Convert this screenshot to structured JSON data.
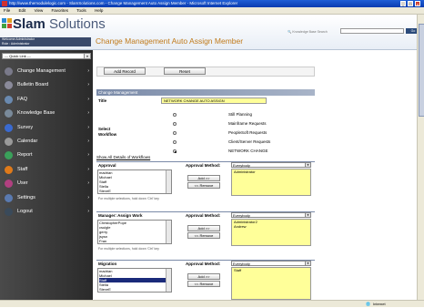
{
  "window": {
    "title": "http://www.themodulelogic.com - SlamSolutions.com - Change Management Auto Assign Member - Microsoft Internet Explorer",
    "min": "_",
    "max": "□",
    "close": "x"
  },
  "menu": [
    "File",
    "Edit",
    "View",
    "Favorites",
    "Tools",
    "Help"
  ],
  "header": {
    "brand_bold": "Slam",
    "brand_light": " Solutions",
    "search_label": "Knowledge Base Search",
    "go": "Go",
    "user_line1": "Welcome Administrator",
    "user_line2": "Role : Administrator",
    "page_title": "Change Management Auto Assign Member"
  },
  "sidebar": {
    "quicklink": "--- Quick Link ---",
    "items": [
      {
        "label": "Change Management",
        "icon": "change-icon",
        "color": "#7a7a8a"
      },
      {
        "label": "Bulletin Board",
        "icon": "bulletin-icon",
        "color": "#8a8a9a"
      },
      {
        "label": "FAQ",
        "icon": "faq-icon",
        "color": "#6a8ab0"
      },
      {
        "label": "Knowledge Base",
        "icon": "knowledge-icon",
        "color": "#7a8a9a"
      },
      {
        "label": "Survey",
        "icon": "survey-icon",
        "color": "#3a6ad0"
      },
      {
        "label": "Calendar",
        "icon": "calendar-icon",
        "color": "#9a9a9a"
      },
      {
        "label": "Report",
        "icon": "report-icon",
        "color": "#3aa05a"
      },
      {
        "label": "Staff",
        "icon": "staff-icon",
        "color": "#e07a1a"
      },
      {
        "label": "User",
        "icon": "user-icon",
        "color": "#b04080"
      },
      {
        "label": "Settings",
        "icon": "settings-icon",
        "color": "#5a7ab0"
      },
      {
        "label": "Logout",
        "icon": "logout-icon",
        "color": "#3a4a5a"
      }
    ]
  },
  "toolbar": {
    "add": "Add Record",
    "reset": "Reset"
  },
  "form": {
    "panel_title": "Change Management",
    "title_label": "Title",
    "title_value": "NETWORK CHANGE AUTO ASSIGN",
    "workflow_label_1": "Select",
    "workflow_label_2": "Workflow",
    "workflows": [
      "Still Planning",
      "Mainframe Requests",
      "PeopleSoft Requests",
      "Client/Server Requests",
      "NETWORK CHANGE"
    ],
    "selected_workflow": 4,
    "show_link": "Show All Details of Workflows"
  },
  "sections": [
    {
      "head": "Approval",
      "method_label": "Approval Method:",
      "method": "Everybody",
      "list": [
        "madrian",
        "Michael",
        "Staff",
        "Stella",
        "SteveE"
      ],
      "assigned": [
        "Administrator"
      ],
      "add": "Add >>",
      "remove": "<< Remove",
      "note": "For multiple selections, hold down 'Ctrl' key"
    },
    {
      "head": "Manager: Assign Work",
      "method_label": "Approval Method:",
      "method": "Everybody",
      "list": [
        "ChristopherPope",
        "csuigle",
        "gerry",
        "jsysn",
        "Fran"
      ],
      "assigned": [
        "Administrator2",
        "Andrew"
      ],
      "add": "Add >>",
      "remove": "<< Remove",
      "note": "For multiple selections, hold down 'Ctrl' key"
    },
    {
      "head": "Migration",
      "method_label": "Approval Method:",
      "method": "Everybody",
      "list": [
        "madrian",
        "Michael",
        "Staff",
        "Stella",
        "SteveE"
      ],
      "selected": 2,
      "assigned": [
        "Staff"
      ],
      "add": "Add >>",
      "remove": "<< Remove"
    }
  ],
  "status": {
    "zone": "Internet"
  }
}
